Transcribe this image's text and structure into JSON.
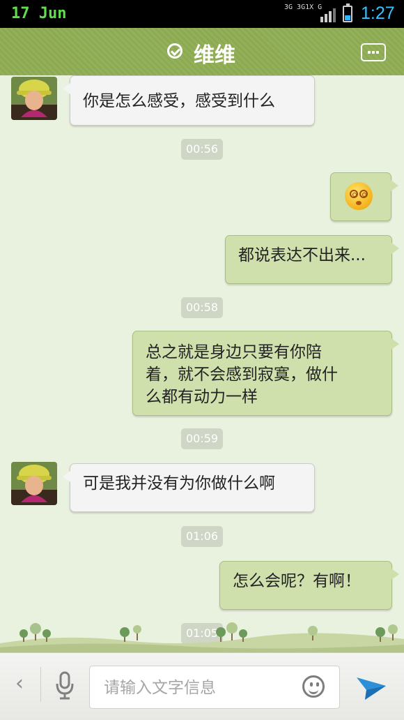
{
  "status_bar": {
    "date": "17 Jun",
    "network_text": "3G 3G1X G",
    "time": "1:27",
    "battery_level": 0.35,
    "battery_color": "#2fb6ff"
  },
  "header": {
    "title": "维维",
    "status_icon": "check-circle-icon",
    "menu_icon": "more-dots-icon",
    "background_color": "#8daa52"
  },
  "messages": [
    {
      "direction": "in",
      "text": "你是怎么感受，感受到什么"
    },
    {
      "type": "timestamp",
      "text": "00:56"
    },
    {
      "direction": "out",
      "type": "emoji",
      "emoji_name": "dizzy-face-emoji"
    },
    {
      "direction": "out",
      "text": "都说表达不出来..."
    },
    {
      "type": "timestamp",
      "text": "00:58"
    },
    {
      "direction": "out",
      "lines": [
        "总之就是身边只要有你陪",
        "着，就不会感到寂寞，做什",
        "么都有动力一样"
      ]
    },
    {
      "type": "timestamp",
      "text": "00:59"
    },
    {
      "direction": "in",
      "text": "可是我并没有为你做什么啊"
    },
    {
      "type": "timestamp",
      "text": "01:06"
    },
    {
      "direction": "out",
      "text": "怎么会呢？有啊！"
    },
    {
      "type": "timestamp",
      "text": "01:05"
    }
  ],
  "input_bar": {
    "placeholder": "请输入文字信息",
    "back_icon": "chevron-left-icon",
    "voice_icon": "microphone-icon",
    "emoji_icon": "smiley-icon",
    "send_icon": "send-arrow-icon"
  },
  "colors": {
    "chat_background": "#e9f1df",
    "incoming_bubble": "#f4f4f4",
    "outgoing_bubble": "#cfe0ad",
    "timestamp_pill": "#cfd6c5"
  }
}
